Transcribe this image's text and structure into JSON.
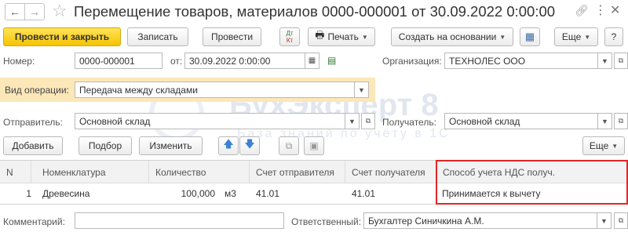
{
  "window": {
    "title": "Перемещение товаров, материалов 0000-000001 от 30.09.2022 0:00:00"
  },
  "toolbar": {
    "post_close": "Провести и закрыть",
    "save": "Записать",
    "post": "Провести",
    "dtkt_top": "Дт",
    "dtkt_bottom": "Кт",
    "print": "Печать",
    "create_based": "Создать на основании",
    "more": "Еще",
    "help": "?"
  },
  "header": {
    "number_label": "Номер:",
    "number_value": "0000-000001",
    "date_label": "от:",
    "date_value": "30.09.2022  0:00:00",
    "org_label": "Организация:",
    "org_value": "ТЕХНОЛЕС ООО",
    "op_label": "Вид операции:",
    "op_value": "Передача между складами",
    "sender_label": "Отправитель:",
    "sender_value": "Основной склад",
    "receiver_label": "Получатель:",
    "receiver_value": "Основной склад"
  },
  "table_toolbar": {
    "add": "Добавить",
    "pick": "Подбор",
    "change": "Изменить",
    "more": "Еще"
  },
  "table": {
    "columns": [
      "N",
      "Номенклатура",
      "Количество",
      "Счет отправителя",
      "Счет получателя",
      "Способ учета НДС получ."
    ],
    "rows": [
      {
        "n": "1",
        "item": "Древесина",
        "qty": "100,000",
        "unit": "м3",
        "acc_from": "41.01",
        "acc_to": "41.01",
        "vat": "Принимается к вычету"
      }
    ]
  },
  "footer": {
    "comment_label": "Комментарий:",
    "comment_value": "",
    "resp_label": "Ответственный:",
    "resp_value": "Бухгалтер Синичкина А.М."
  },
  "watermark": {
    "brand": "БухЭксперт 8",
    "tagline": "База знаний по учёту в 1С"
  },
  "colors": {
    "primary_button": "#f5c400",
    "highlight_field": "#fbe7b8",
    "red_frame": "#e32626",
    "arrow_blue": "#3b82d6"
  }
}
